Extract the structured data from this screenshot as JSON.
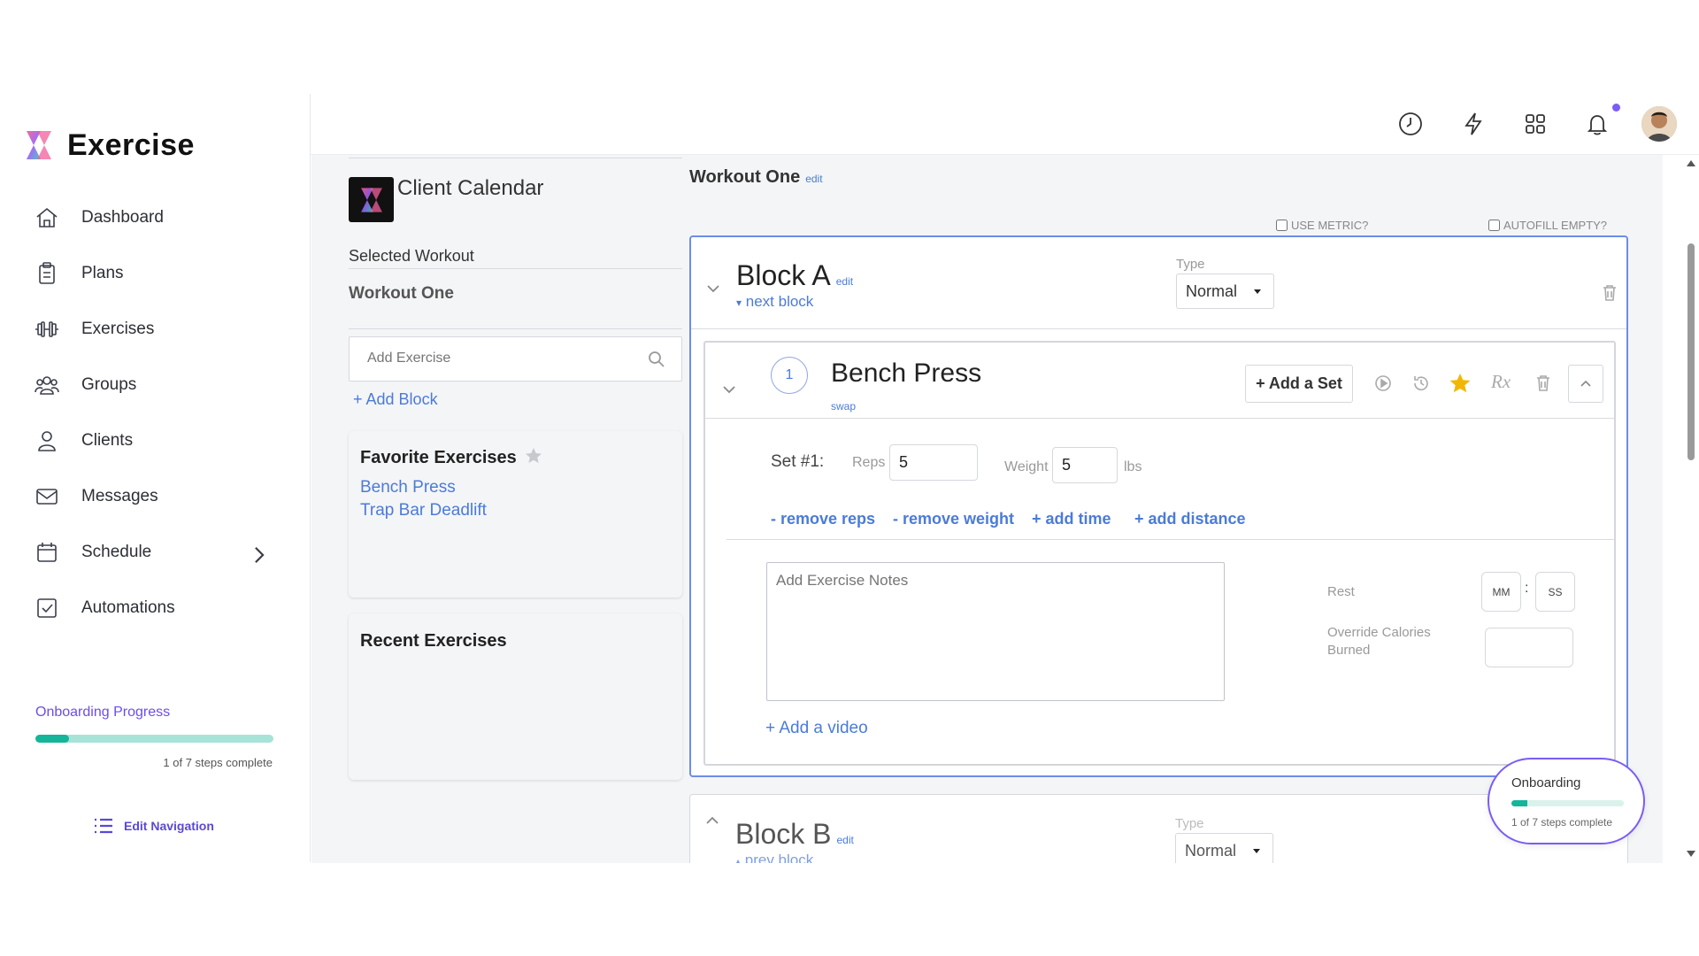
{
  "app": {
    "name": "Exercise"
  },
  "sidebar": {
    "items": [
      {
        "label": "Dashboard",
        "icon": "home-icon"
      },
      {
        "label": "Plans",
        "icon": "clipboard-icon"
      },
      {
        "label": "Exercises",
        "icon": "dumbbell-icon"
      },
      {
        "label": "Groups",
        "icon": "users-icon"
      },
      {
        "label": "Clients",
        "icon": "user-icon"
      },
      {
        "label": "Messages",
        "icon": "mail-icon"
      },
      {
        "label": "Schedule",
        "icon": "calendar-icon"
      },
      {
        "label": "Automations",
        "icon": "checkbox-icon"
      }
    ],
    "onboarding": {
      "title": "Onboarding Progress",
      "progress": 0.1428,
      "status": "1 of 7 steps complete"
    },
    "edit_navigation": "Edit Navigation"
  },
  "topbar": {
    "icons": [
      "clock-icon",
      "lightning-icon",
      "grid-icon",
      "bell-icon",
      "avatar"
    ]
  },
  "calendar": {
    "title": "Client Calendar"
  },
  "selected_workout": {
    "label": "Selected Workout",
    "value": "Workout One"
  },
  "add_exercise": {
    "placeholder": "Add Exercise"
  },
  "add_block": "+ Add Block",
  "favorites": {
    "title": "Favorite Exercises",
    "items": [
      "Bench Press",
      "Trap Bar Deadlift"
    ]
  },
  "recent": {
    "title": "Recent Exercises"
  },
  "workout": {
    "title": "Workout One",
    "edit": "edit",
    "use_metric": "USE METRIC?",
    "autofill_empty": "AUTOFILL EMPTY?"
  },
  "block_a": {
    "title": "Block A",
    "edit": "edit",
    "nav": "next block",
    "type_label": "Type",
    "type_value": "Normal",
    "exercise": {
      "number": "1",
      "name": "Bench Press",
      "swap": "swap",
      "add_set": "+ Add a Set",
      "rx": "Rx",
      "set": {
        "label": "Set #1:",
        "reps_label": "Reps",
        "reps_value": "5",
        "weight_label": "Weight",
        "weight_value": "5",
        "unit": "lbs"
      },
      "links": [
        "- remove reps",
        "- remove weight",
        "+ add time",
        "+ add distance"
      ],
      "notes_placeholder": "Add Exercise Notes",
      "rest_label": "Rest",
      "rest_mm": "MM",
      "rest_sep": ":",
      "rest_ss": "SS",
      "calories_label": "Override Calories Burned",
      "add_video": "+ Add a video"
    }
  },
  "block_b": {
    "title": "Block B",
    "edit": "edit",
    "nav": "prev block",
    "type_label": "Type",
    "type_value": "Normal"
  },
  "onboarding_popup": {
    "title": "Onboarding",
    "progress": 0.1428,
    "status": "1 of 7 steps complete"
  },
  "colors": {
    "accent": "#4b7bd8",
    "brand_purple": "#7b5cf5",
    "progress_green": "#15b59a",
    "star": "#f2b705"
  }
}
